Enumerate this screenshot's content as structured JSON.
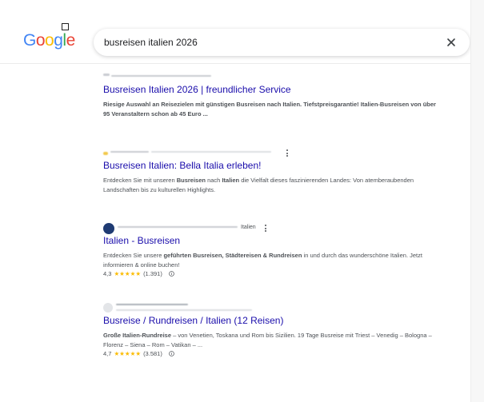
{
  "logo": {
    "letters": [
      "G",
      "o",
      "o",
      "g",
      "l",
      "e"
    ],
    "colors": [
      "#4285f4",
      "#ea4335",
      "#fbbc05",
      "#4285f4",
      "#34a853",
      "#ea4335"
    ]
  },
  "search": {
    "query": "busreisen italien 2026",
    "placeholder": ""
  },
  "icons": {
    "clear": "close-icon",
    "more": "kebab-menu-icon",
    "info": "info-icon"
  },
  "results": [
    {
      "title": "Busreisen Italien 2026 | freundlicher Service",
      "snippet": [
        {
          "t": "Riesige Auswahl an Reisezielen mit günstigen Busreisen nach Italien. Tiefstpreisgarantie! Italien-Busreisen von über 95 Veranstaltern schon ab 45 Euro ...",
          "b": true
        }
      ]
    },
    {
      "title": "Busreisen Italien: Bella Italia erleben!",
      "snippet": [
        {
          "t": "Entdecken Sie mit unseren ",
          "b": false
        },
        {
          "t": "Busreisen",
          "b": true
        },
        {
          "t": " nach ",
          "b": false
        },
        {
          "t": "Italien",
          "b": true
        },
        {
          "t": " die Vielfalt dieses faszinierenden Landes: Von atemberaubenden Landschaften bis zu kulturellen Highlights.",
          "b": false
        }
      ]
    },
    {
      "site_label": "Italien",
      "title": "Italien - Busreisen",
      "snippet": [
        {
          "t": "Entdecken Sie unsere ",
          "b": false
        },
        {
          "t": "geführten Busreisen, Städtereisen & Rundreisen",
          "b": true
        },
        {
          "t": " in und durch das wunderschöne Italien. Jetzt informieren & online buchen!",
          "b": false
        }
      ],
      "rating": {
        "value": "4,3",
        "stars": "★★★★★",
        "count": "(1.391)",
        "score": 4.3
      }
    },
    {
      "title": "Busreise / Rundreisen / Italien (12 Reisen)",
      "snippet": [
        {
          "t": "Große Italien-Rundreise",
          "b": true
        },
        {
          "t": " – von Venetien, Toskana und Rom bis Sizilien. 19 Tage Busreise mit Triest – Venedig – Bologna – Florenz – Siena – Rom – Vatikan – ...",
          "b": false
        }
      ],
      "rating": {
        "value": "4,7",
        "stars": "★★★★★",
        "count": "(3.581)",
        "score": 4.7
      }
    }
  ]
}
